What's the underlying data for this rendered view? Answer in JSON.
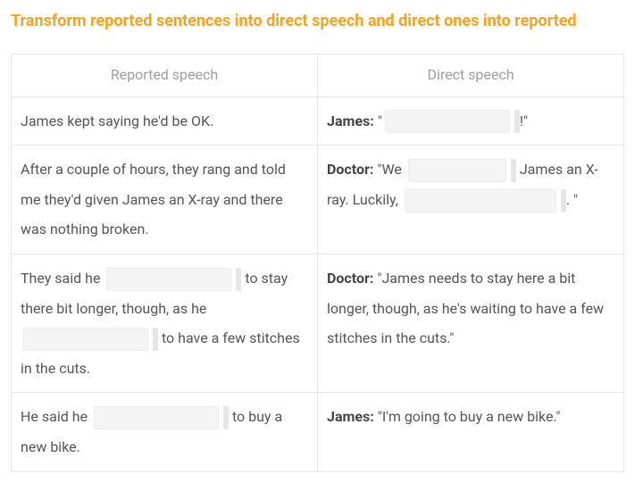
{
  "title": "Transform reported sentences into direct speech and direct ones into reported",
  "headers": {
    "left": "Reported speech",
    "right": "Direct speech"
  },
  "rows": [
    {
      "left": {
        "text": "James kept saying he'd be OK."
      },
      "right": {
        "speaker": "James:",
        "pre": " \"",
        "post": "!\""
      }
    },
    {
      "left": {
        "text": "After a couple of hours, they rang and told me they'd given James an X-ray and there was nothing broken."
      },
      "right": {
        "speaker": "Doctor:",
        "pre": " \"We ",
        "mid": " James an X-ray. Luckily, ",
        "post": ". \""
      }
    },
    {
      "left": {
        "pre": "They said he ",
        "mid": " to stay there bit longer, though, as he ",
        "post": " to have a few stitches in the cuts."
      },
      "right": {
        "speaker": "Doctor:",
        "text": " \"James needs to stay here a bit longer, though, as he's waiting to have a few stitches in the cuts.\""
      }
    },
    {
      "left": {
        "pre": "He said he ",
        "post": " to buy a new bike."
      },
      "right": {
        "speaker": "James:",
        "text": " \"I'm going to buy a new bike.\""
      }
    }
  ]
}
